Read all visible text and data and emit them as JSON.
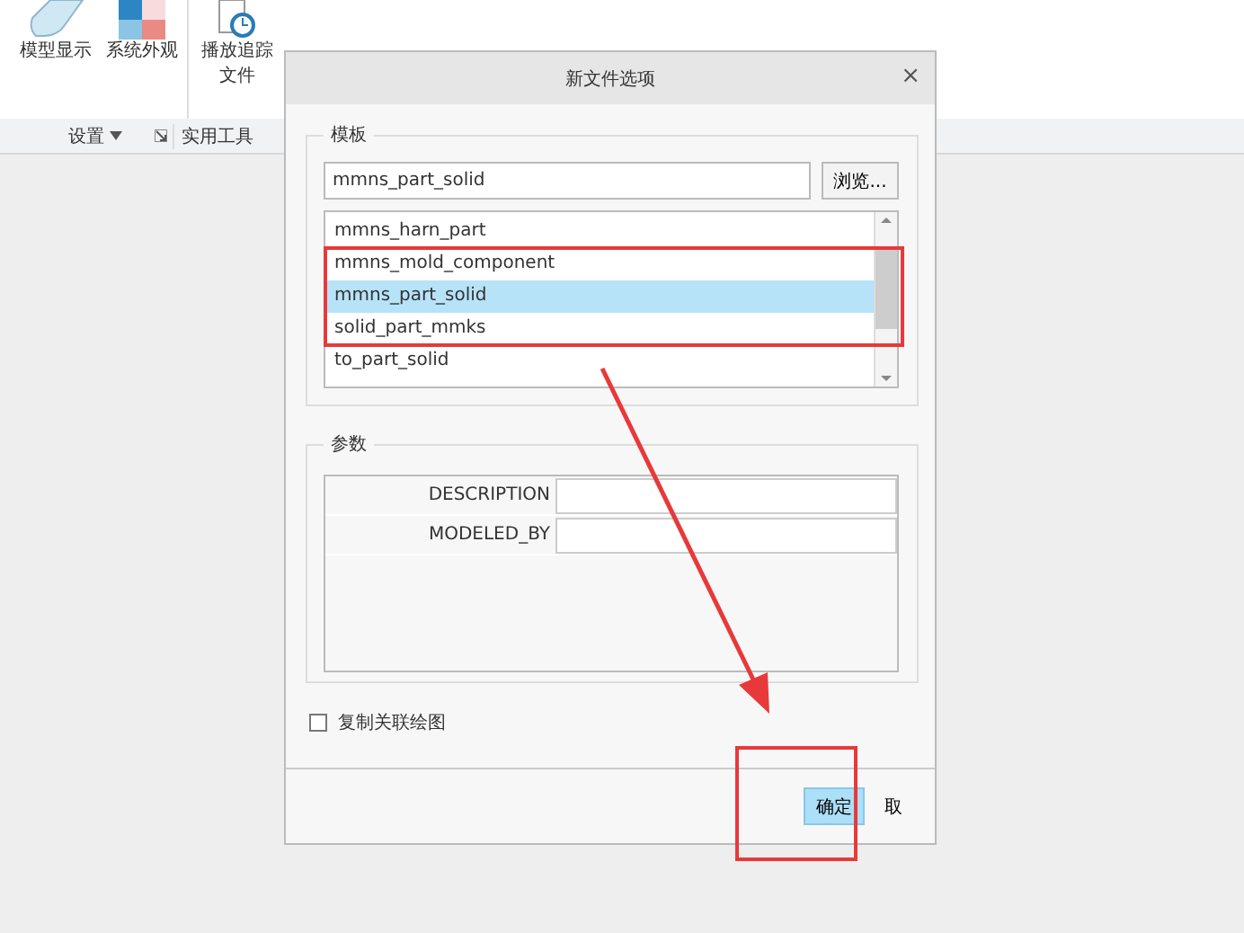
{
  "ribbon": {
    "buttons": [
      {
        "label": "模型显示",
        "kind": "eraser"
      },
      {
        "label": "系统外观",
        "kind": "palette"
      },
      {
        "label": "播放追踪",
        "label2": "文件",
        "kind": "trace"
      }
    ],
    "groups": [
      {
        "label": "设置",
        "dropdown": true,
        "launcher": true
      },
      {
        "label": "实用工具",
        "dropdown": false,
        "launcher": false
      }
    ]
  },
  "dialog": {
    "title": "新文件选项",
    "close": "×",
    "template": {
      "legend": "模板",
      "value": "mmns_part_solid",
      "browse": "浏览...",
      "items": [
        {
          "label": "mmns_harn_part",
          "selected": false
        },
        {
          "label": "mmns_mold_component",
          "selected": false
        },
        {
          "label": "mmns_part_solid",
          "selected": true
        },
        {
          "label": "solid_part_mmks",
          "selected": false
        },
        {
          "label": "to_part_solid",
          "selected": false
        }
      ]
    },
    "params": {
      "legend": "参数",
      "rows": [
        {
          "name": "DESCRIPTION"
        },
        {
          "name": "MODELED_BY"
        }
      ]
    },
    "copy_drawing": {
      "label": "复制关联绘图",
      "checked": false
    },
    "buttons": [
      {
        "label": "确定",
        "primary": true
      },
      {
        "label": "取",
        "primary": false
      }
    ]
  }
}
